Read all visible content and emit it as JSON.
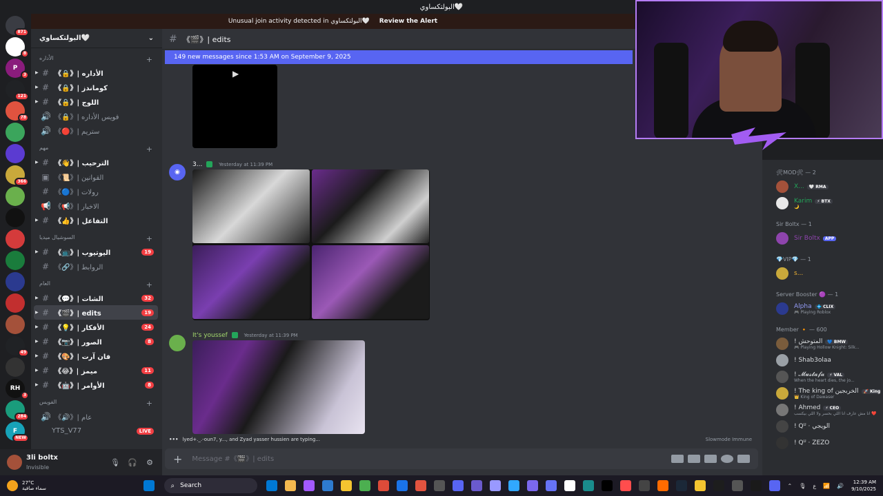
{
  "window": {
    "title": "البولتكساوي🤍"
  },
  "alert": {
    "text": "Unusual join activity detected in البولتكساوي🤍",
    "action": "Review the Alert"
  },
  "guilds": [
    {
      "label": "",
      "color": "#3a3c43",
      "badge": "871"
    },
    {
      "label": "",
      "color": "#ffffff",
      "badge": "8"
    },
    {
      "label": "P",
      "color": "#8a1c7c",
      "badge": "3"
    },
    {
      "label": "",
      "color": "#202225",
      "badge": "121"
    },
    {
      "label": "",
      "color": "#e0533f",
      "badge": "78"
    },
    {
      "label": "",
      "color": "#3ba55c",
      "badge": ""
    },
    {
      "label": "",
      "color": "#5b3bd1",
      "badge": ""
    },
    {
      "label": "",
      "color": "#c9a93b",
      "badge": "366"
    },
    {
      "label": "",
      "color": "#6ab04c",
      "badge": ""
    },
    {
      "label": "",
      "color": "#111111",
      "badge": ""
    },
    {
      "label": "",
      "color": "#d43b3b",
      "badge": ""
    },
    {
      "label": "",
      "color": "#1a7c3c",
      "badge": ""
    },
    {
      "label": "",
      "color": "#2b3a8f",
      "badge": ""
    },
    {
      "label": "",
      "color": "#c22f2f",
      "badge": ""
    },
    {
      "label": "",
      "color": "#a4513a",
      "badge": ""
    },
    {
      "label": "",
      "color": "#202225",
      "badge": "49"
    },
    {
      "label": "",
      "color": "#333333",
      "badge": ""
    },
    {
      "label": "RH",
      "color": "#111111",
      "badge": "3"
    },
    {
      "label": "",
      "color": "#1a9c7c",
      "badge": "284"
    },
    {
      "label": "F",
      "color": "#17a2b8",
      "badge": "NEW"
    }
  ],
  "sidebar": {
    "server_name": "البولتكساوي🤍",
    "categories": [
      {
        "name": "الأداره",
        "channels": [
          {
            "label": "《🔒》| الأداره",
            "unread": true,
            "count": "",
            "icon": "#"
          },
          {
            "label": "《🔒》| كوماندز",
            "unread": true,
            "count": "",
            "icon": "#"
          },
          {
            "label": "《🔒》| اللوج",
            "unread": true,
            "count": "",
            "icon": "#"
          },
          {
            "label": "《🔒》| فويس الأداره",
            "unread": false,
            "count": "",
            "icon": "🔊"
          },
          {
            "label": "《🔴》| ستريم",
            "unread": false,
            "count": "",
            "icon": "🔊"
          }
        ]
      },
      {
        "name": "مهم",
        "channels": [
          {
            "label": "《👋》| الترحيب",
            "unread": true,
            "count": "",
            "icon": "#"
          },
          {
            "label": "《📜》| القوانين",
            "unread": false,
            "count": "",
            "icon": "▣"
          },
          {
            "label": "《🔵》| رولات",
            "unread": false,
            "count": "",
            "icon": "#"
          },
          {
            "label": "《📢》| الاخبار",
            "unread": false,
            "count": "",
            "icon": "📢"
          },
          {
            "label": "《👍》| التفاعل",
            "unread": true,
            "count": "",
            "icon": "#"
          }
        ]
      },
      {
        "name": "السوشيال ميديا",
        "channels": [
          {
            "label": "《📺》| اليوتيوب",
            "unread": true,
            "count": "19",
            "icon": "#"
          },
          {
            "label": "《🔗》| الروابط",
            "unread": false,
            "count": "",
            "icon": "#"
          }
        ]
      },
      {
        "name": "العام",
        "channels": [
          {
            "label": "《💬》| الشات",
            "unread": true,
            "count": "32",
            "icon": "#"
          },
          {
            "label": "《🎬》| edits",
            "unread": true,
            "count": "19",
            "icon": "#",
            "active": true
          },
          {
            "label": "《💡》| الأفكار",
            "unread": true,
            "count": "24",
            "icon": "#"
          },
          {
            "label": "《📷》| الصور",
            "unread": true,
            "count": "8",
            "icon": "#"
          },
          {
            "label": "《🎨》| فان آرت",
            "unread": true,
            "count": "",
            "icon": "#"
          },
          {
            "label": "《😂》| ميمز",
            "unread": true,
            "count": "11",
            "icon": "#"
          },
          {
            "label": "《🤖》| الأوامر",
            "unread": true,
            "count": "8",
            "icon": "#"
          }
        ]
      },
      {
        "name": "الفويس",
        "channels": [
          {
            "label": "《🔊》| عام",
            "unread": false,
            "count": "",
            "icon": "🔊"
          }
        ]
      }
    ],
    "voice_user": "YTS_V77",
    "live_label": "LIVE"
  },
  "user": {
    "name": "3li boltx",
    "status": "Invisible"
  },
  "chat": {
    "channel_title": "《🎬》| edits",
    "new_messages": "149 new messages since 1:53 AM on September 9, 2025",
    "messages": [
      {
        "author": "3...",
        "time": "Yesterday at 11:39 PM"
      },
      {
        "author": "It's youssef",
        "time": "Yesterday at 11:39 PM"
      }
    ],
    "typing": "lyed+._.-oun7, y..., and Zyad yasser hussien are typing...",
    "slowmode": "Slowmode Immune",
    "composer_placeholder": "Message #《🎬》| edits"
  },
  "members": {
    "groups": [
      {
        "name": "🛠MOD🛠 — 2",
        "members": [
          {
            "name": "X...",
            "badge": "🤍 RMA",
            "sub": "",
            "color": "#23a55a"
          },
          {
            "name": "Karim",
            "badge": "⚡ BTX",
            "sub": "🌙",
            "color": "#23a55a"
          }
        ]
      },
      {
        "name": "Sir Boltx — 1",
        "members": [
          {
            "name": "Sir Boltx",
            "app": "APP",
            "sub": "",
            "color": "#8e44ad"
          }
        ]
      },
      {
        "name": "💎VIP💎 — 1",
        "members": [
          {
            "name": "s...",
            "badge": "",
            "sub": "",
            "color": "#f0b232"
          }
        ]
      },
      {
        "name": "Server Booster 🟣 — 1",
        "members": [
          {
            "name": "Alpha",
            "badge": "💠 CLIX",
            "sub": "🎮 Playing Roblox",
            "color": "#949cf7"
          }
        ]
      },
      {
        "name": "Member 🔸 — 600",
        "members": [
          {
            "name": "! المتوحش",
            "badge": "💙 BMW",
            "sub": "🎮 Playing Hollow Knight: Silk...",
            "color": "#dbdee1"
          },
          {
            "name": "! Shab3olaa",
            "badge": "",
            "sub": "",
            "color": "#dbdee1"
          },
          {
            "name": "! 𝓜𝓾𝓼𝓽𝓪𝓯𝓪",
            "badge": "⚡ VAL",
            "sub": "When the heart dies, the jo...",
            "color": "#dbdee1"
          },
          {
            "name": "! The king of الخربجين",
            "badge": "🚀 King",
            "sub": "👑 King of Dawaser",
            "color": "#dbdee1"
          },
          {
            "name": "! Ahmed",
            "badge": "⚡ CEO",
            "sub": "انا مش عارف انا اللي بخسر ولا اللي بيكسب ❤️",
            "color": "#dbdee1"
          },
          {
            "name": "! Qᵁ · الويجي",
            "badge": "",
            "sub": "",
            "color": "#dbdee1"
          },
          {
            "name": "! Qᵁ · ZEZO",
            "badge": "",
            "sub": "",
            "color": "#dbdee1"
          }
        ]
      }
    ]
  },
  "taskbar": {
    "weather_temp": "27°C",
    "weather_desc": "سماء صافية",
    "search": "Search",
    "icons": [
      "#0078d4",
      "#f3b84f",
      "#a259ff",
      "#2e7bcf",
      "#f4c430",
      "#4caf50",
      "#dd4b39",
      "#1a73e8",
      "#e2533f",
      "#555",
      "#5865f2",
      "#6a5acd",
      "#9999ff",
      "#31a8ff",
      "#7b68ee",
      "#6673f5",
      "#ffffff",
      "#1a8c8c",
      "#000000",
      "#ff4d4d",
      "#444",
      "#ff6b00",
      "#1b2838",
      "#f4c430",
      "#1d1d1d",
      "#555",
      "#1a1a1a",
      "#5865f2"
    ],
    "lang": "ع",
    "time": "12:39 AM",
    "date": "9/10/2025"
  }
}
